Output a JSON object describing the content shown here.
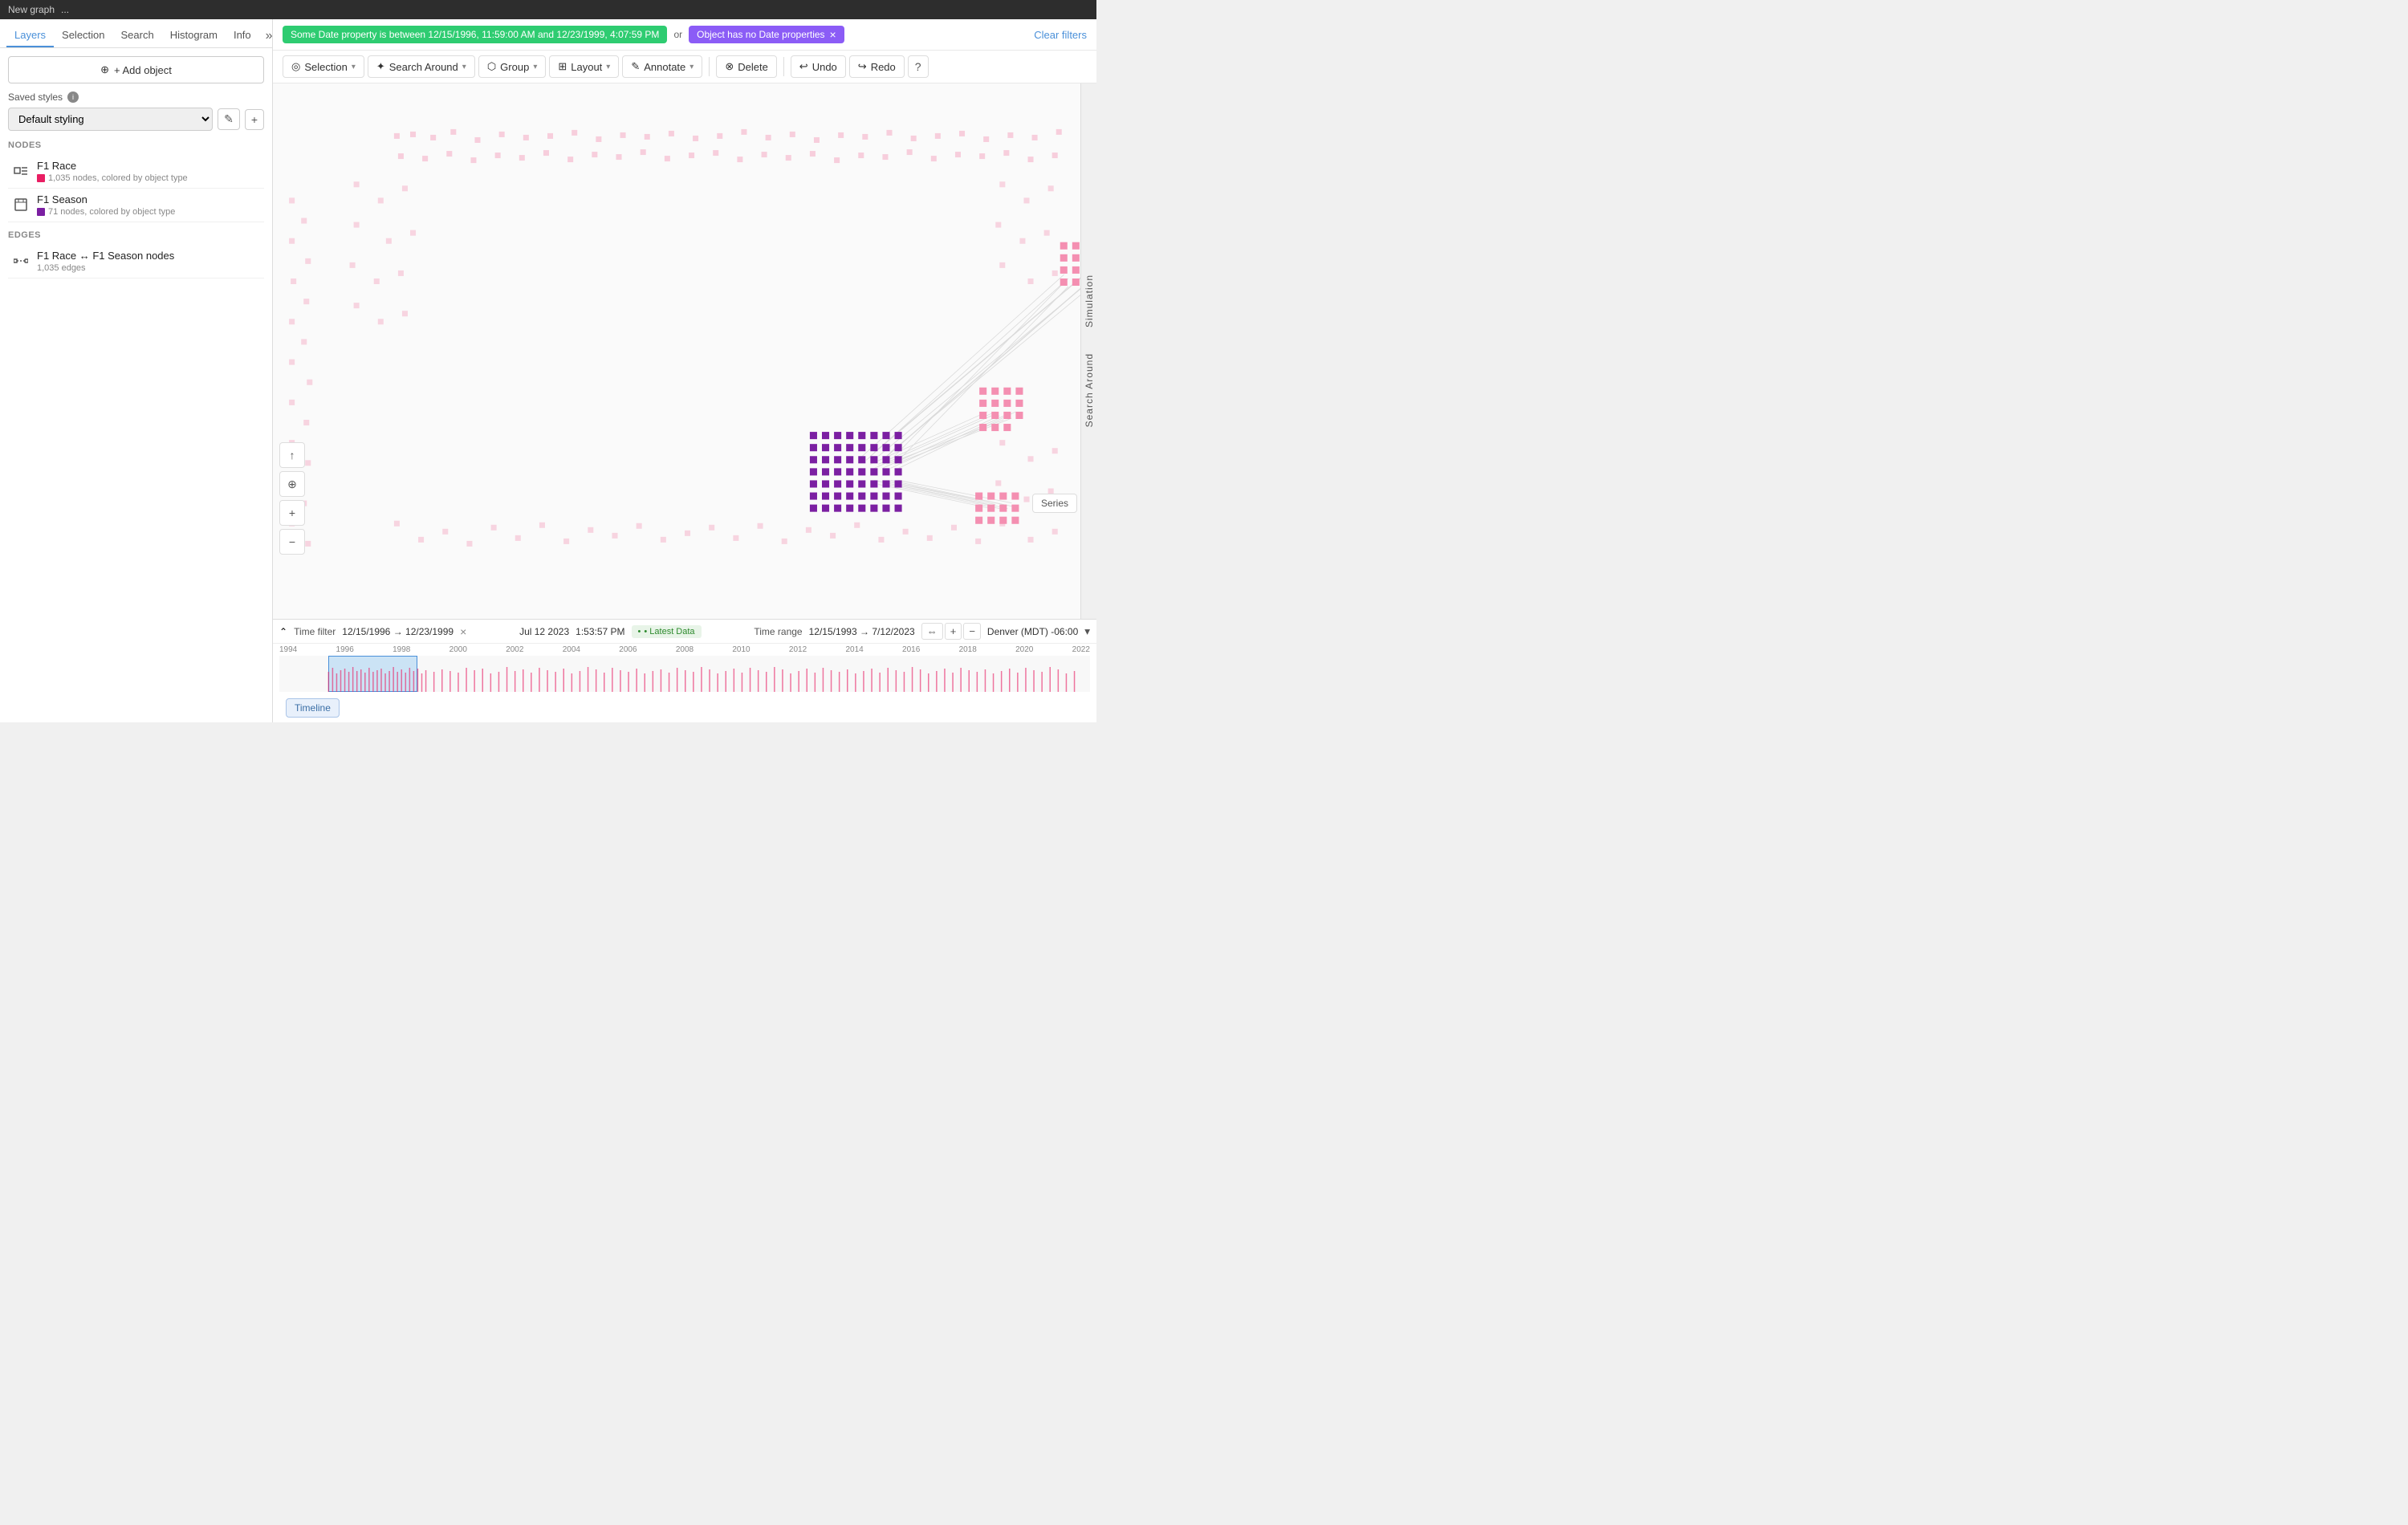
{
  "titleBar": {
    "label": "New graph",
    "ellipsis": "..."
  },
  "sidebar": {
    "tabs": [
      "Layers",
      "Selection",
      "Search",
      "Histogram",
      "Info"
    ],
    "activeTab": "Layers",
    "collapseLabel": "»",
    "addObjectBtn": "+ Add object",
    "savedStylesLabel": "Saved styles",
    "styleOptions": [
      "Default styling"
    ],
    "selectedStyle": "Default styling",
    "editIcon": "✎",
    "addIcon": "+",
    "nodesLabel": "NODES",
    "edgesLabel": "EDGES",
    "nodes": [
      {
        "name": "F1 Race",
        "meta": "1,035 nodes, colored by object type",
        "color": "#e91e63",
        "iconType": "race"
      },
      {
        "name": "F1 Season",
        "meta": "71 nodes, colored by object type",
        "color": "#7b1fa2",
        "iconType": "season"
      }
    ],
    "edges": [
      {
        "name": "F1 Race ↔ F1 Season nodes",
        "meta": "1,035 edges",
        "iconType": "edge"
      }
    ]
  },
  "filterBar": {
    "greenBadge": "Some Date property is between 12/15/1996, 11:59:00 AM and 12/23/1999, 4:07:59 PM",
    "orLabel": "or",
    "purpleBadge": "Object has no Date properties",
    "clearFilters": "Clear filters"
  },
  "toolbar": {
    "selection": "Selection",
    "searchAround": "Search Around",
    "group": "Group",
    "layout": "Layout",
    "annotate": "Annotate",
    "delete": "Delete",
    "undo": "Undo",
    "redo": "Redo",
    "helpIcon": "?"
  },
  "rightPanel": {
    "tabs": [
      "Simulation",
      "Search Around"
    ]
  },
  "leftControls": {
    "upload": "↑",
    "crosshair": "⊕",
    "zoomIn": "+",
    "zoomOut": "−"
  },
  "timeline": {
    "filterLabel": "Time filter",
    "filterRange": "12/15/1996 → 12/23/1999",
    "closeBtn": "×",
    "currentDate": "Jul 12 2023",
    "currentTime": "1:53:57 PM",
    "latestData": "• Latest Data",
    "timeRangeLabel": "Time range",
    "timeRange": "12/15/1993 → 7/12/2023",
    "timezone": "Denver (MDT) -06:00",
    "timelineBtn": "Timeline",
    "seriesBtn": "Series",
    "rulers": [
      "1994",
      "1996",
      "1998",
      "2000",
      "2002",
      "2004",
      "2006",
      "2008",
      "2010",
      "2012",
      "2014",
      "2016",
      "2018",
      "2020",
      "2022"
    ]
  }
}
